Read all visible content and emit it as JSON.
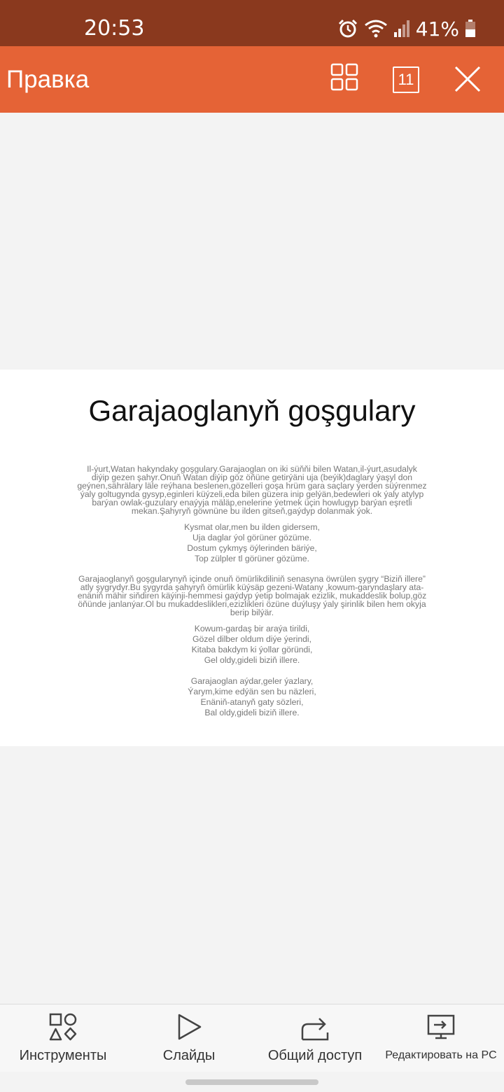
{
  "status_bar": {
    "time": "20:53",
    "battery_percent": "41%"
  },
  "toolbar": {
    "title": "Правка",
    "slide_count": "11",
    "background_color": "#e56336"
  },
  "slide": {
    "title": "Garajaoglanyň goşgulary",
    "intro": "Il-ýurt,Watan hakyndaky goşgulary.Garajaoglan on iki süňňi bilen Watan,il-ýurt,asudalyk diýip gezen şahyr.Onuň Watan diýip göz öňüne getirýäni uja (beýik)daglary ýaşyl don geýnen,sährälary läle reýhana beslenen,gözelleri goşa hrüm gara saçlary ýerden süýrenmez ýaly goltugynda gysyp,eginleri küýzeli,eda bilen güzera inip gelýän,bedewleri ok ýaly atylyp barýan owlak-guzulary enaýyja mäläp,enelerine ýetmek üçin howlugyp barýan eşretli mekan.Şahyryň göwnüne bu ilden gitseň,gaýdyp dolanmak ýok.",
    "stanza1": [
      "Kysmat olar,men bu ilden gidersem,",
      "Uja daglar ýol görüner gözüme.",
      "Dostum çykmyş öýlerinden bäriýe,",
      "Top zülpler tl görüner gözüme."
    ],
    "middle": "Garajaoglanyň goşgularynyň içinde onuň ömürlikdiliniň senasyna öwrülen şygry “Biziň illere” atly şygrydyr.Bu şygyrda şahyryň ömürlik küýsäp gezeni-Watany ,kowum-garyndaşlary ata-enäniň mähir siňdiren käýinji-hemmesi gaýdyp ýetip bolmajak ezizlik, mukaddeslik bolup,göz öňünde janlanýar.Ol bu mukaddeslikleri,ezizlikleri özüne duýluşy ýaly şirinlik bilen hem okyja berip bilýär.",
    "stanza2": [
      "Kowum-gardaş bir araýa tirildi,",
      "Gözel dilber oldum diýe ýerindi,",
      "Kitaba bakdym ki ýollar göründi,",
      "Gel oldy,gideli biziň illere."
    ],
    "stanza3": [
      "Garajaoglan aýdar,geler ýazlary,",
      "Ýarym,kime edýän sen bu näzleri,",
      "Enäniň-atanyň gaty sözleri,",
      "Bal oldy,gideli biziň illere."
    ]
  },
  "bottom_bar": {
    "tools": "Инструменты",
    "slides": "Слайды",
    "share": "Общий доступ",
    "edit_pc": "Редактировать на PC"
  }
}
